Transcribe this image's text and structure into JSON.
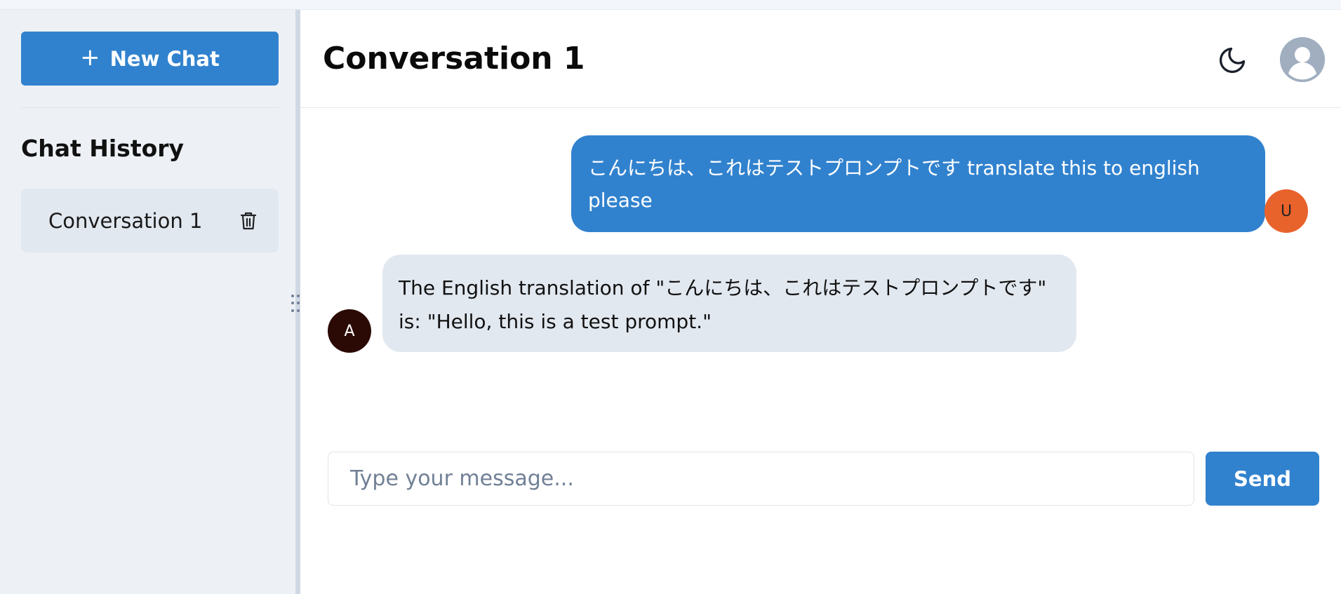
{
  "sidebar": {
    "new_chat_label": "New Chat",
    "new_chat_icon": "plus-icon",
    "history_title": "Chat History",
    "items": [
      {
        "label": "Conversation 1",
        "icon": "trash-icon"
      }
    ]
  },
  "header": {
    "title": "Conversation 1",
    "theme_icon": "moon-icon",
    "profile_icon": "user-avatar-icon"
  },
  "messages": [
    {
      "role": "user",
      "text": "こんにちは、これはテストプロンプトです translate this to english please",
      "avatar": "U"
    },
    {
      "role": "assistant",
      "text": "The English translation of \"こんにちは、これはテストプロンプトです\" is: \"Hello, this is a test prompt.\"",
      "avatar": "A"
    }
  ],
  "composer": {
    "placeholder": "Type your message...",
    "value": "",
    "send_label": "Send"
  },
  "colors": {
    "accent": "#3182ce",
    "sidebar_bg": "#edf1f6",
    "assistant_bubble": "#e2e8f0",
    "user_avatar": "#e8622c",
    "assistant_avatar": "#2b0a05"
  }
}
